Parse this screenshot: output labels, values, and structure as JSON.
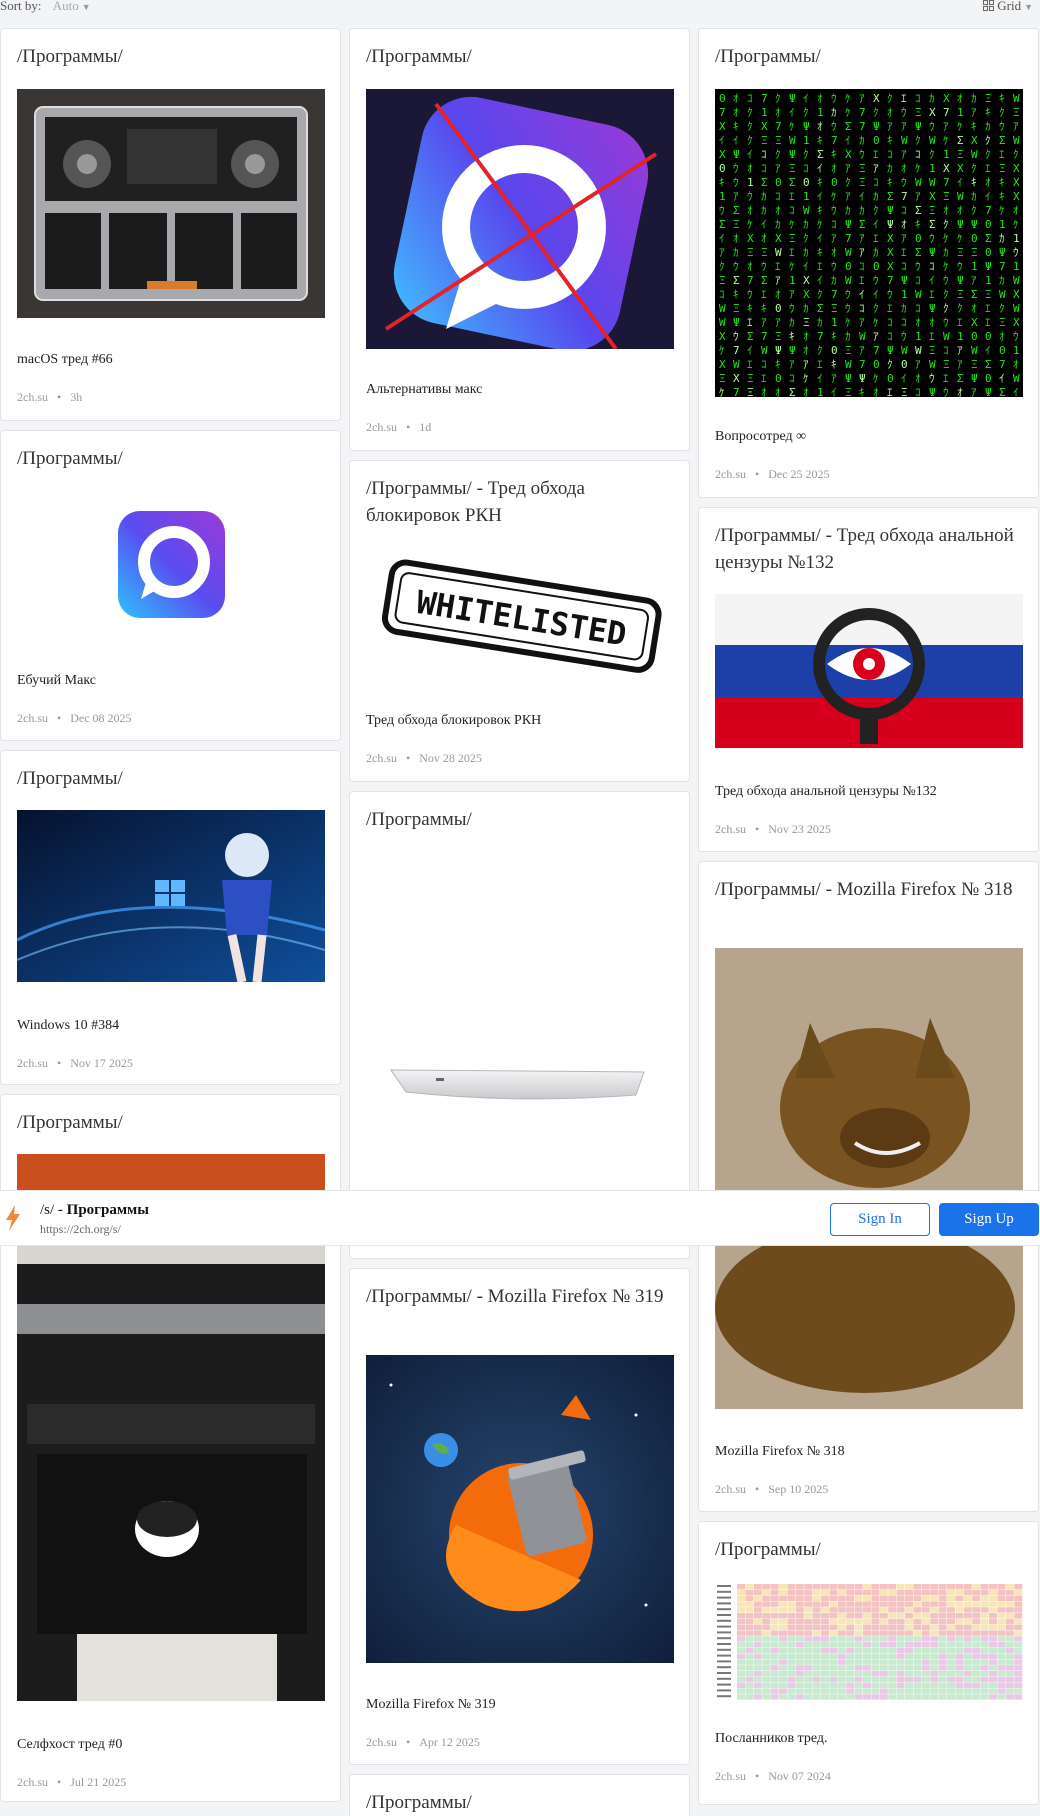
{
  "toolbar": {
    "sort_label": "Sort by:",
    "sort_value": "Auto",
    "view_value": "Grid"
  },
  "cards": [
    {
      "title": "/Программы/",
      "name": "macOS тред #66",
      "source": "2ch.su",
      "time": "3h"
    },
    {
      "title": "/Программы/",
      "name": "Ебучий Макс",
      "source": "2ch.su",
      "time": "Dec 08 2025"
    },
    {
      "title": "/Программы/",
      "name": "Windows 10 #384",
      "source": "2ch.su",
      "time": "Nov 17 2025"
    },
    {
      "title": "/Программы/",
      "name": "Селфхост тред #0",
      "source": "2ch.su",
      "time": "Jul 21 2025"
    },
    {
      "title": "/Программы/",
      "name": "Альтернативы макс",
      "source": "2ch.su",
      "time": "1d"
    },
    {
      "title": "/Программы/ - Тред обхода блокировок РКН",
      "name": "Тред обхода блокировок РКН",
      "source": "2ch.su",
      "time": "Nov 28 2025",
      "image_text": "WHITELISTED"
    },
    {
      "title": "/Программы/"
    },
    {
      "title": "/Программы/ - Mozilla Firefox № 319",
      "name": "Mozilla Firefox № 319",
      "source": "2ch.su",
      "time": "Apr 12 2025"
    },
    {
      "title": "/Программы/"
    },
    {
      "title": "/Программы/",
      "name": "Вопросотред ∞",
      "source": "2ch.su",
      "time": "Dec 25 2025"
    },
    {
      "title": "/Программы/ - Тред обхода анальной цензуры №132",
      "name": "Тред обхода анальной цензуры №132",
      "source": "2ch.su",
      "time": "Nov 23 2025"
    },
    {
      "title": "/Программы/ - Mozilla Firefox № 318",
      "name": "Mozilla Firefox № 318",
      "source": "2ch.su",
      "time": "Sep 10 2025"
    },
    {
      "title": "/Программы/",
      "name": "Посланников тред.",
      "source": "2ch.su",
      "time": "Nov 07 2024"
    }
  ],
  "banner": {
    "prefix": "/s/ - ",
    "name": "Программы",
    "url": "https://2ch.org/s/",
    "sign_in": "Sign In",
    "sign_up": "Sign Up"
  },
  "colors": {
    "accent": "#1a73e8",
    "bolt": "#f2893a"
  }
}
